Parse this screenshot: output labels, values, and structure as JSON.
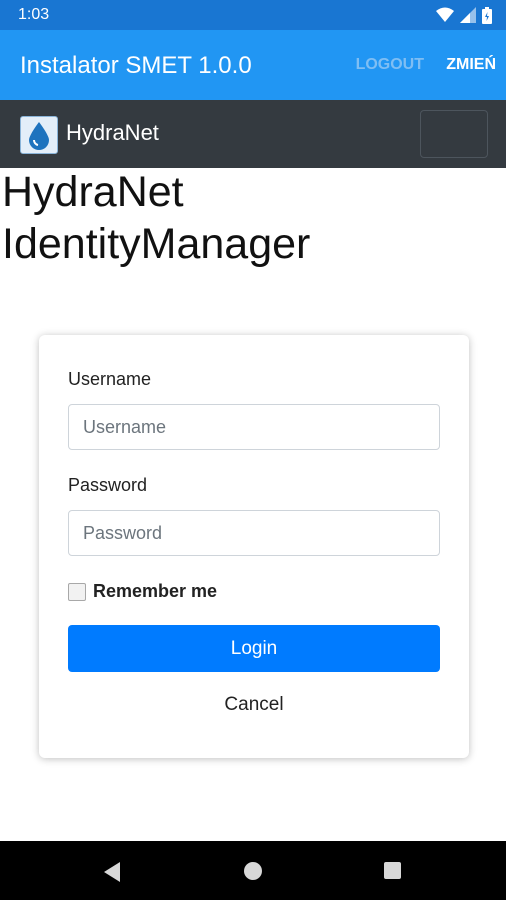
{
  "status_bar": {
    "time": "1:03",
    "icons": [
      "wifi-icon",
      "signal-icon",
      "battery-icon"
    ]
  },
  "app_bar": {
    "title": "Instalator SMET 1.0.0",
    "logout_label": "LOGOUT",
    "change_label": "ZMIEŃ"
  },
  "navbar": {
    "brand": "HydraNet",
    "logo_icon": "water-drop-icon",
    "toggler_icon": "menu-toggle-icon"
  },
  "page": {
    "heading_line1": "HydraNet",
    "heading_line2": "IdentityManager"
  },
  "login_form": {
    "username_label": "Username",
    "username_placeholder": "Username",
    "password_label": "Password",
    "password_placeholder": "Password",
    "remember_label": "Remember me",
    "remember_checked": false,
    "login_label": "Login",
    "cancel_label": "Cancel"
  },
  "system_nav": {
    "icons": [
      "back-icon",
      "home-icon",
      "recents-icon"
    ]
  },
  "colors": {
    "status_bar": "#1976d2",
    "app_bar": "#2196f3",
    "navbar": "#343a40",
    "primary_button": "#007bff"
  }
}
